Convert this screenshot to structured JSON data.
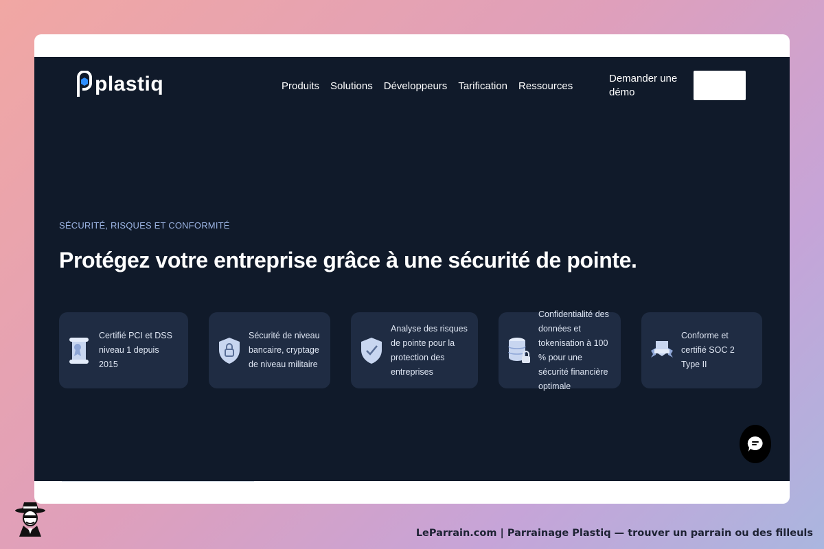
{
  "brand": {
    "name": "plastiq",
    "logo_icon": "plastiq-logo-icon"
  },
  "nav": {
    "links": [
      "Produits",
      "Solutions",
      "Développeurs",
      "Tarification",
      "Ressources"
    ],
    "demo_label": "Demander une démo",
    "cta_label": ""
  },
  "hero": {
    "eyebrow": "SÉCURITÉ, RISQUES ET CONFORMITÉ",
    "headline": "Protégez votre entreprise grâce à une sécurité de pointe."
  },
  "features": [
    {
      "icon": "certificate-scroll-icon",
      "text": "Certifié PCI et DSS niveau 1 depuis 2015"
    },
    {
      "icon": "shield-lock-icon",
      "text": "Sécurité de niveau bancaire, cryptage de niveau militaire"
    },
    {
      "icon": "shield-check-icon",
      "text": "Analyse des risques de pointe pour la protection des entreprises"
    },
    {
      "icon": "database-lock-icon",
      "text": "Confidentialité des données et tokenisation à 100 % pour une sécurité financière optimale"
    },
    {
      "icon": "award-badge-icon",
      "text": "Conforme et certifié SOC 2 Type II"
    }
  ],
  "chat": {
    "icon": "chat-bubble-icon"
  },
  "footer": {
    "caption": "LeParrain.com | Parrainage Plastiq — trouver un parrain ou des filleuls",
    "mascot_icon": "spy-mascot-icon"
  },
  "colors": {
    "page_bg": "#101a2a",
    "card_bg": "#1f2c43",
    "eyebrow": "#9bb3e2",
    "logo_accent": "#2f8fff"
  }
}
